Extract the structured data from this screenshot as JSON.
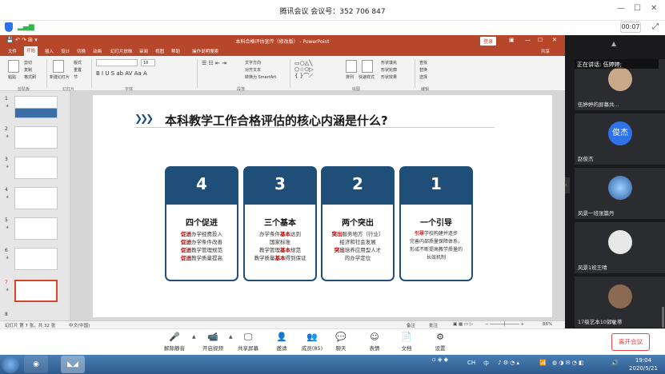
{
  "window": {
    "title": "腾讯会议 会议号：352 706 847",
    "timer": "00:07"
  },
  "ppt": {
    "doc_title": "本科合格评估宣传（修改版） - PowerPoint",
    "login": "登录",
    "share": "共享",
    "tabs": [
      "文件",
      "开始",
      "插入",
      "设计",
      "切换",
      "动画",
      "幻灯片放映",
      "审阅",
      "视图",
      "帮助",
      "操作说明搜索"
    ],
    "ribbon": {
      "paste": "粘贴",
      "cut": "剪切",
      "copy": "复制",
      "format_painter": "格式刷",
      "new_slide": "新建幻灯片",
      "layout": "版式",
      "reset": "重置",
      "section": "节",
      "font_size": "18",
      "text_direction": "文字方向",
      "align_text": "对齐文本",
      "smartart": "转换为 SmartArt",
      "shapes": "形状",
      "arrange": "排列",
      "quick_styles": "快速样式",
      "shape_fill": "形状填充",
      "shape_outline": "形状轮廓",
      "shape_effects": "形状效果",
      "find": "查找",
      "replace": "替换",
      "select": "选择",
      "groups": [
        "剪贴板",
        "幻灯片",
        "字体",
        "段落",
        "绘图",
        "编辑"
      ]
    },
    "thumbs": [
      {
        "n": "1",
        "star": "★"
      },
      {
        "n": "2",
        "star": "★"
      },
      {
        "n": "3",
        "star": "★"
      },
      {
        "n": "4",
        "star": "★"
      },
      {
        "n": "5",
        "star": "★"
      },
      {
        "n": "6",
        "star": "★"
      },
      {
        "n": "7",
        "star": "★"
      },
      {
        "n": "8",
        "star": ""
      }
    ],
    "slide": {
      "title": "本科教学工作合格评估的核心内涵是什么?",
      "chevrons": "❯❯❯",
      "cards": [
        {
          "num": "4",
          "heading": "四个促进",
          "lines": [
            [
              "促进",
              "办学经费投入"
            ],
            [
              "促进",
              "办学条件改善"
            ],
            [
              "促进",
              "教学管理规范"
            ],
            [
              "促进",
              "教学质量提高"
            ]
          ]
        },
        {
          "num": "3",
          "heading": "三个基本",
          "lines": [
            [
              "办学条件",
              "基本",
              "达到"
            ],
            [
              "",
              "国家标准",
              ""
            ],
            [
              "教学管理",
              "基本",
              "规范"
            ],
            [
              "教学质量",
              "基本",
              "得到保证"
            ]
          ]
        },
        {
          "num": "2",
          "heading": "两个突出",
          "lines": [
            [
              "突出",
              "服务地方（行业）"
            ],
            [
              "",
              "经济和社会发展"
            ],
            [
              "突出",
              "培养应用型人才"
            ],
            [
              "",
              "的办学定位"
            ]
          ]
        },
        {
          "num": "1",
          "heading": "一个引导",
          "lines": [
            [
              "引导",
              "学校构建并逐步"
            ],
            [
              "",
              "完善内部质量保障体系，"
            ],
            [
              "",
              "形成不断提高教学质量的"
            ],
            [
              "",
              "长效机制"
            ]
          ]
        }
      ]
    },
    "status": {
      "slide_no": "幻灯片 第 7 张，共 32 张",
      "lang": "中文(中国)",
      "notes": "备注",
      "comments": "批注",
      "zoom": "86%"
    }
  },
  "right_panel": {
    "speaking": "正在讲话: 伍婷婷;",
    "tiles": [
      {
        "name": "伍婷婷的屏幕共...",
        "avatar": "",
        "color": "#c9a98a"
      },
      {
        "name": "赵俊杰",
        "avatar": "俊杰",
        "color": "#2e72e8"
      },
      {
        "name": "风景一班张篇丹",
        "avatar": "",
        "color": "#4a8fd6"
      },
      {
        "name": "风景1班王晴",
        "avatar": "",
        "color": "#e0e0e0"
      },
      {
        "name": "17级艺本10郭杜蒂",
        "avatar": "",
        "color": "#8a6a50"
      }
    ]
  },
  "toolbar": {
    "buttons": [
      {
        "label": "解除静音",
        "icon": "🎤"
      },
      {
        "label": "开启视频",
        "icon": "📹"
      },
      {
        "label": "共享屏幕",
        "icon": "🖵"
      },
      {
        "label": "邀请",
        "icon": "👤"
      },
      {
        "label": "成员(85)",
        "icon": "👥"
      },
      {
        "label": "聊天",
        "icon": "💬"
      },
      {
        "label": "表情",
        "icon": "☺"
      },
      {
        "label": "文档",
        "icon": "📄"
      },
      {
        "label": "设置",
        "icon": "⚙"
      }
    ],
    "leave": "离开会议"
  },
  "taskbar": {
    "time": "19:04",
    "date": "2020/5/21",
    "ime": "中",
    "zh": "CH"
  }
}
